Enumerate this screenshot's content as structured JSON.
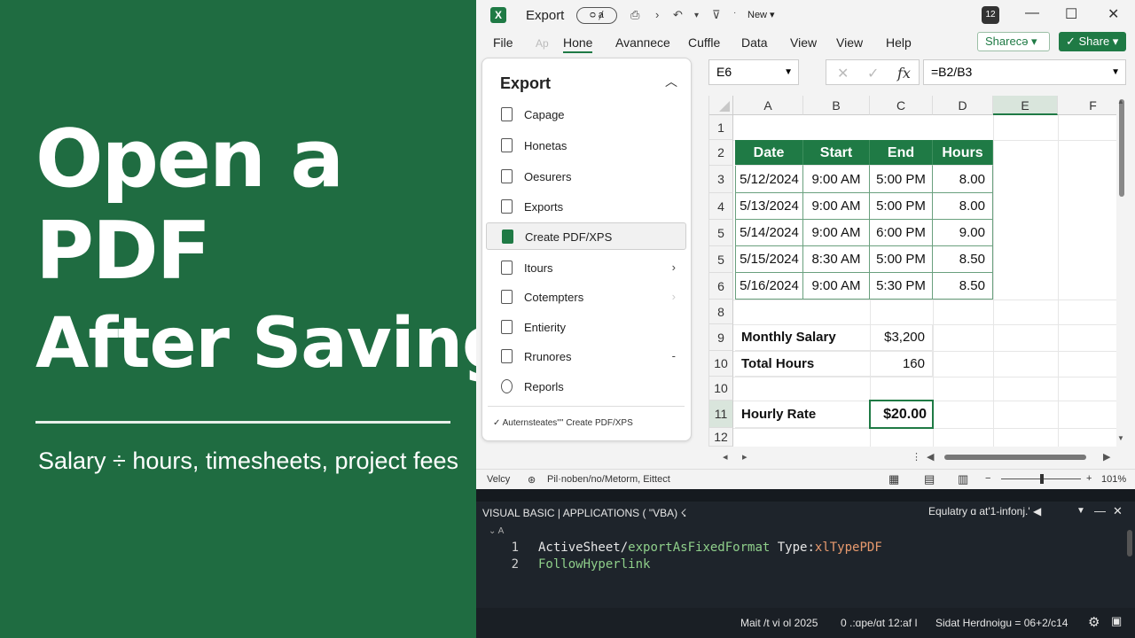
{
  "headline": {
    "line1": "Open a",
    "line2": "PDF",
    "line3": "After Saving",
    "subtitle": "Salary ÷ hours, timesheets, project fees"
  },
  "titlebar": {
    "app_icon": "X",
    "doc_title": "Export",
    "autosave": "ᴑ ⱥ",
    "new_label": "New ▾",
    "account": "12",
    "minimize": "—",
    "maximize": "☐",
    "close": "✕"
  },
  "menu": {
    "file": "File",
    "ap": "Ap",
    "home": "Hone",
    "advanced": "Avanпece",
    "cuffle": "Cuffle",
    "data": "Data",
    "view1": "View",
    "view2": "View",
    "help": "Help",
    "shareto": "Shareсә ▾",
    "share": "✓ Share ▾"
  },
  "export_panel": {
    "title": "Export",
    "items": [
      {
        "label": "Capage",
        "chevron": ""
      },
      {
        "label": "Honetas",
        "chevron": ""
      },
      {
        "label": "Oesurers",
        "chevron": ""
      },
      {
        "label": "Exports",
        "chevron": ""
      },
      {
        "label": "Create PDF/XPS",
        "chevron": ""
      },
      {
        "label": "Itours",
        "chevron": "›"
      },
      {
        "label": "Cotempters",
        "chevron": "›"
      },
      {
        "label": "Entierity",
        "chevron": ""
      },
      {
        "label": "Rrunores",
        "chevron": "-"
      },
      {
        "label": "Reporls",
        "chevron": ""
      }
    ],
    "footer": "✓  Auternsteates\"\" Create PDF/XPS"
  },
  "formula_bar": {
    "name_box": "E6",
    "formula": "=B2/B3",
    "cancel": "✕",
    "enter": "✓",
    "fx": "fx"
  },
  "sheet": {
    "columns": [
      "A",
      "B",
      "C",
      "D",
      "E",
      "F"
    ],
    "rows": [
      "1",
      "2",
      "3",
      "4",
      "5",
      "5",
      "6",
      "8",
      "9",
      "10",
      "10",
      "11",
      "12"
    ],
    "table_headers": [
      "Date",
      "Start",
      "End",
      "Hours"
    ],
    "table_rows": [
      [
        "5/12/2024",
        "9:00 AM",
        "5:00 PM",
        "8.00"
      ],
      [
        "5/13/2024",
        "9:00 AM",
        "5:00 PM",
        "8.00"
      ],
      [
        "5/14/2024",
        "9:00 AM",
        "6:00 PM",
        "9.00"
      ],
      [
        "5/15/2024",
        "8:30 AM",
        "5:00 PM",
        "8.50"
      ],
      [
        "5/16/2024",
        "9:00 AM",
        "5:30 PM",
        "8.50"
      ]
    ],
    "monthly_salary_label": "Monthly Salary",
    "monthly_salary_value": "$3,200",
    "total_hours_label": "Total Hours",
    "total_hours_value": "160",
    "hourly_rate_label": "Hourly Rate",
    "hourly_rate_value": "$20.00"
  },
  "statusbar": {
    "ready": "Velcy",
    "accessibility": "Pil·noben/nо/Metorm, Eittect",
    "zoom": "101%"
  },
  "vba": {
    "title": "VISUAL BASIC | APPLICATIONS ( \"VBA) ☇",
    "right_label": "Equlatry ɑ at'1-infonj.' ◀",
    "lines": [
      {
        "num": "1",
        "a": "ActiveSheet/",
        "b": "exportAsFixedFormat",
        "c": " Type:",
        "d": "xlTypePDF"
      },
      {
        "num": "2",
        "a": "FollowHyperlink"
      }
    ],
    "status_date": "Mait /t vi ol 2025",
    "status_pos": "0 .:ɑpe/ɑt 12:af I",
    "status_extra": "Sidat Herdnoigu  = 06+2/c14"
  }
}
